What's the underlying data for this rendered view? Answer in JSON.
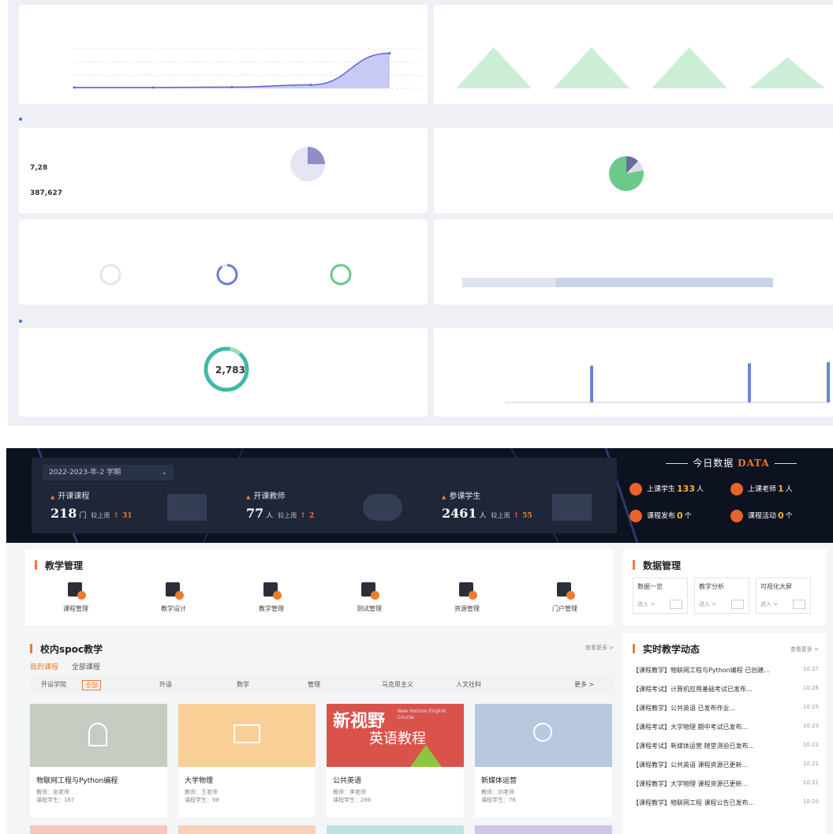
{
  "analytics": {
    "cards": [
      {
        "title": "",
        "note": ""
      },
      {
        "title": "",
        "note": ""
      }
    ],
    "big_numbers": {
      "a": "7,28",
      "b": "387,627"
    },
    "ring_center": {
      "value": "2,783"
    },
    "chart_data": [
      {
        "type": "area",
        "title": "",
        "x": [
          "",
          "",
          "",
          "",
          ""
        ],
        "series": [
          {
            "values": [
              1,
              1,
              1.5,
              4,
              40
            ]
          }
        ],
        "ylim": [
          0,
          45
        ],
        "grid": true
      },
      {
        "type": "area",
        "title": "",
        "categories": [
          "",
          "",
          "",
          ""
        ],
        "series": [
          {
            "values": [
              28,
              28,
              28,
              21
            ]
          }
        ],
        "ylim": [
          0,
          30
        ]
      },
      {
        "type": "pie",
        "title": "",
        "values": [
          25,
          75
        ]
      },
      {
        "type": "pie",
        "title": "",
        "values": [
          12,
          10,
          78
        ]
      },
      {
        "type": "bar",
        "title": "",
        "categories": [
          "",
          "",
          "",
          "",
          ""
        ],
        "values": [
          0,
          30,
          0,
          32,
          33
        ],
        "ylim": [
          0,
          40
        ]
      }
    ],
    "progress": {
      "values": [
        0.0,
        0.9,
        1.0
      ]
    },
    "stacked_bar": {
      "fractions": [
        0.3,
        0.7
      ]
    }
  },
  "dash": {
    "term": "2022-2023-年-2  学期",
    "stats": [
      {
        "label": "开课课程",
        "value": "218",
        "unit": "门",
        "cmp": "较上周",
        "delta": "31"
      },
      {
        "label": "开课教师",
        "value": "77",
        "unit": "人",
        "cmp": "较上周",
        "delta": "2"
      },
      {
        "label": "参课学生",
        "value": "2461",
        "unit": "人",
        "cmp": "较上周",
        "delta": "55"
      }
    ],
    "today": {
      "title_cn": "今日数据",
      "title_en": "DATA",
      "items": [
        {
          "label": "上课学生",
          "value": "133",
          "unit": "人"
        },
        {
          "label": "上课老师",
          "value": "1",
          "unit": "人"
        },
        {
          "label": "课程发布",
          "value": "0",
          "unit": "个"
        },
        {
          "label": "课程活动",
          "value": "0",
          "unit": "个"
        }
      ]
    },
    "teaching": {
      "title": "教学管理",
      "tools": [
        "课程管理",
        "教学设计",
        "教学管理",
        "测试管理",
        "资源管理",
        "门户管理"
      ]
    },
    "data_mgmt": {
      "title": "数据管理",
      "boxes": [
        {
          "label": "数据一览",
          "enter": "进入 >"
        },
        {
          "label": "教学分析",
          "enter": "进入 >"
        },
        {
          "label": "可视化大屏",
          "enter": "进入 >"
        }
      ]
    },
    "spoc": {
      "title": "校内spoc教学",
      "more": "查看更多 >",
      "tabs": [
        "我的课程",
        "全部课程"
      ],
      "filters": [
        "开设学院",
        "全部",
        "外语",
        "数学",
        "管理",
        "马克思主义",
        "人文社科",
        "更多 >"
      ],
      "courses": [
        {
          "name": "物联网工程与Python编程",
          "meta1": "教师：张老师",
          "meta2": "课程学生：187"
        },
        {
          "name": "大学物理",
          "meta1": "教师：王老师",
          "meta2": "课程学生：98"
        },
        {
          "name": "公共英语",
          "meta1": "教师：李老师",
          "meta2": "课程学生：286",
          "cover_text": "新视野",
          "cover_sub": "英语教程",
          "cover_en": "New Horizon English Course"
        },
        {
          "name": "新媒体运营",
          "meta1": "教师：刘老师",
          "meta2": "课程学生：76"
        }
      ]
    },
    "news": {
      "title": "实时教学动态",
      "more": "查看更多 >",
      "items": [
        {
          "text": "【课程教学】物联网工程与Python编程 已创建...",
          "time": "10:27"
        },
        {
          "text": "【课程考试】计算机应用基础考试已发布...",
          "time": "10:26"
        },
        {
          "text": "【课程教学】公共英语 已发布作业...",
          "time": "10:25"
        },
        {
          "text": "【课程考试】大学物理 期中考试已发布...",
          "time": "10:23"
        },
        {
          "text": "【课程考试】新媒体运营 随堂测验已发布...",
          "time": "10:22"
        },
        {
          "text": "【课程教学】公共英语 课程资源已更新...",
          "time": "10:21"
        },
        {
          "text": "【课程教学】大学物理 课程资源已更新...",
          "time": "10:21"
        },
        {
          "text": "【课程教学】物联网工程 课程公告已发布...",
          "time": "10:20"
        }
      ]
    }
  }
}
